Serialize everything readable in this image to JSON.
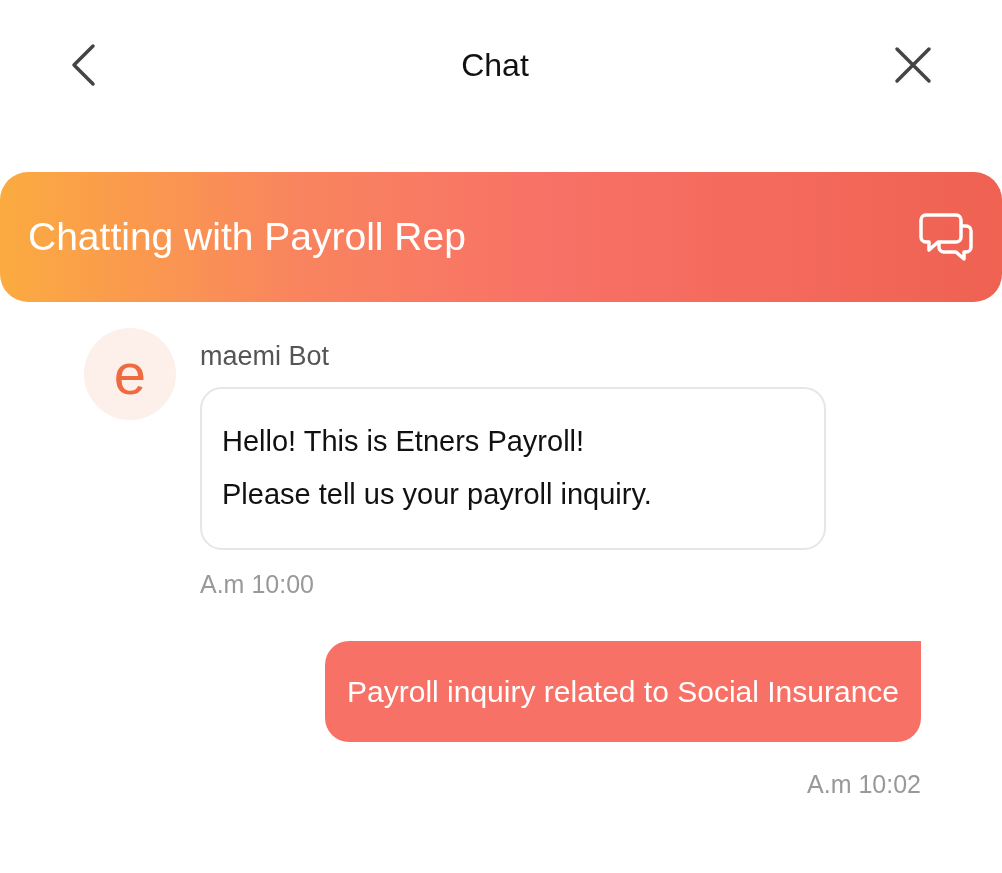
{
  "header": {
    "title": "Chat"
  },
  "banner": {
    "title": "Chatting with Payroll Rep"
  },
  "messages": [
    {
      "kind": "bot",
      "sender": "maemi Bot",
      "avatar": "e",
      "lines": [
        "Hello! This is Etners Payroll!",
        "Please tell us your payroll inquiry."
      ],
      "time": "A.m 10:00"
    },
    {
      "kind": "user",
      "lines": [
        "Payroll inquiry related to Social Insurance"
      ],
      "time": "A.m 10:02"
    }
  ]
}
